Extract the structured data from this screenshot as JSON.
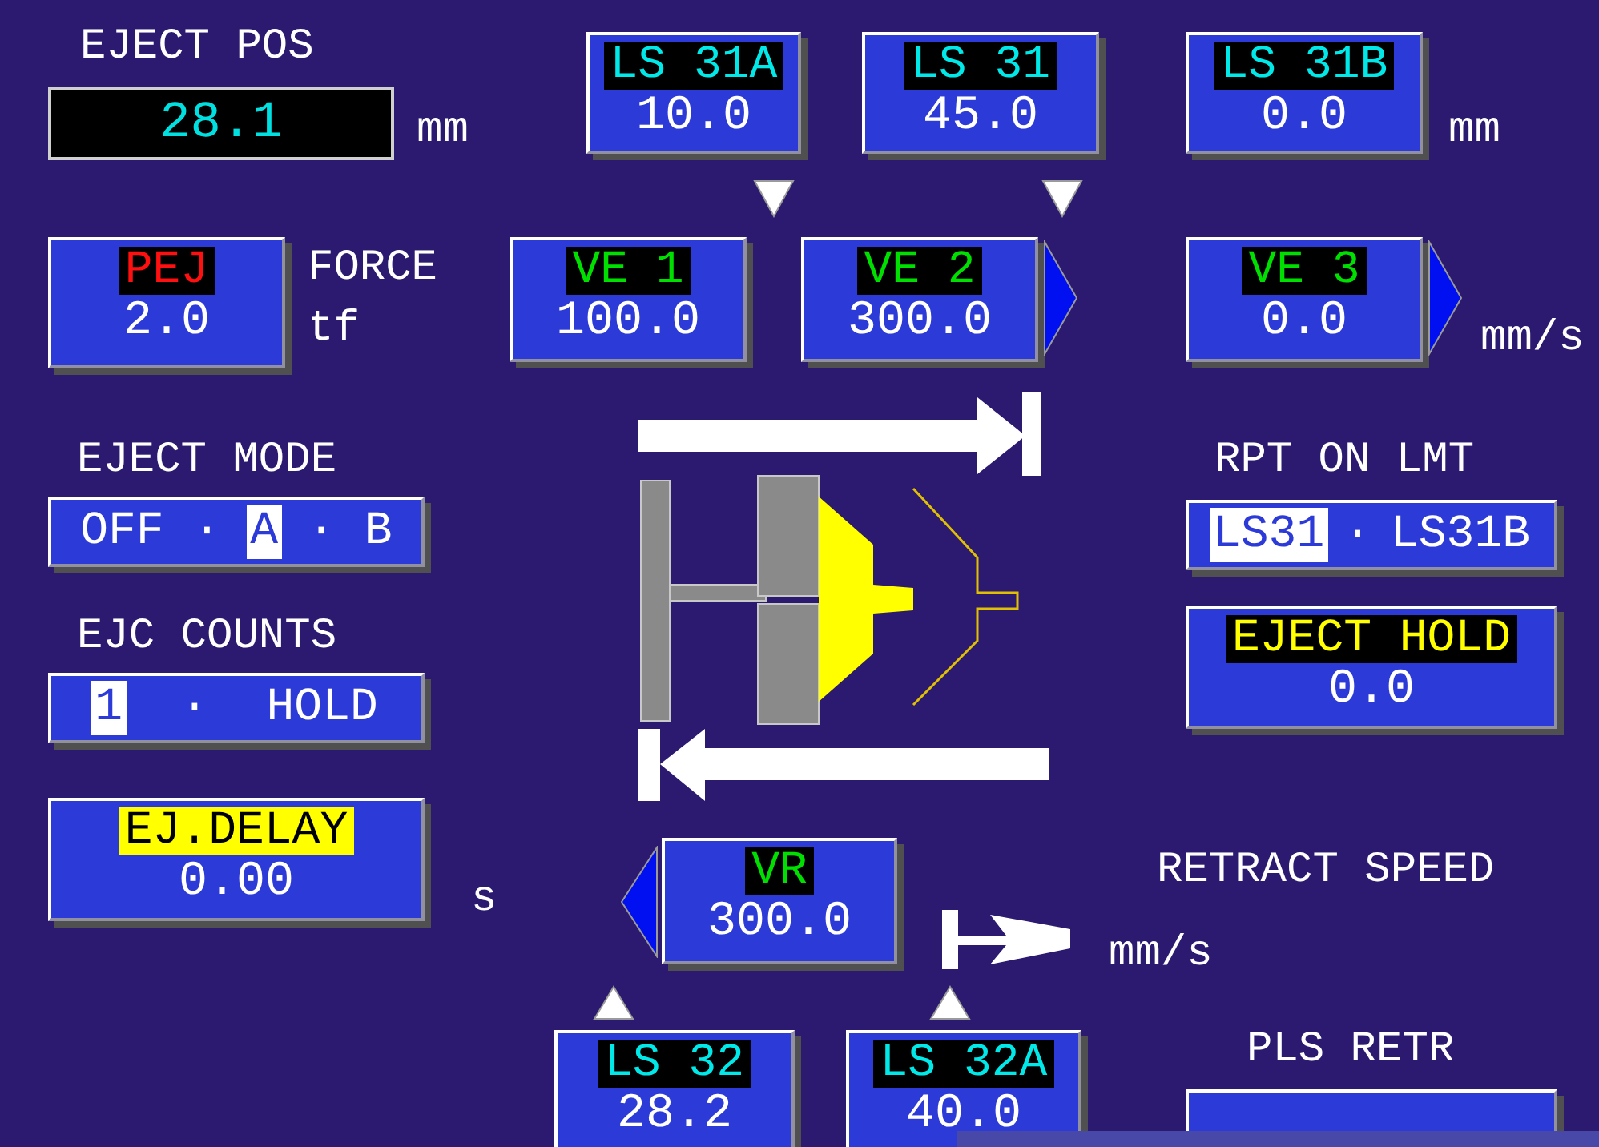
{
  "eject_pos": {
    "value": "28.1"
  },
  "setting_boxes": [
    {
      "label": "LS 31A",
      "value": "10.0",
      "kind": "cyan"
    },
    {
      "label": "LS 31",
      "value": "45.0",
      "kind": "cyan"
    },
    {
      "label": "LS 31B",
      "value": "0.0",
      "kind": "cyan"
    },
    {
      "label": "PEJ",
      "value": "2.0",
      "kind": "red"
    },
    {
      "label": "VE 1",
      "value": "100.0",
      "kind": "green"
    },
    {
      "label": "VE 2",
      "value": "300.0",
      "kind": "green"
    },
    {
      "label": "VE 3",
      "value": "0.0",
      "kind": "green"
    },
    {
      "label": "EJECT HOLD",
      "value": "0.0",
      "kind": "yellow"
    },
    {
      "label": "EJ.DELAY",
      "value": "0.00",
      "kind": "highlight"
    },
    {
      "label": "VR",
      "value": "300.0",
      "kind": "green"
    },
    {
      "label": "LS 32",
      "value": "28.2",
      "kind": "cyan"
    },
    {
      "label": "LS 32A",
      "value": "40.0",
      "kind": "cyan"
    }
  ],
  "captions": [
    "EJECT POS",
    "mm",
    "mm",
    "FORCE",
    "tf",
    "mm/s",
    "EJECT MODE",
    "EJC COUNTS",
    "RPT ON LMT",
    "s",
    "RETRACT SPEED",
    "mm/s",
    "PLS RETR"
  ],
  "selectors": [
    {
      "options": [
        {
          "text": "OFF",
          "kind": "option",
          "selected": false
        },
        {
          "text": "·",
          "kind": "separator"
        },
        {
          "text": "A",
          "kind": "option",
          "selected": true
        },
        {
          "text": "·",
          "kind": "separator"
        },
        {
          "text": "B",
          "kind": "option",
          "selected": false
        }
      ]
    },
    {
      "options": [
        {
          "text": "1",
          "kind": "option",
          "selected": true
        },
        {
          "text": "·",
          "kind": "separator"
        },
        {
          "text": "HOLD",
          "kind": "option",
          "selected": false
        }
      ]
    },
    {
      "options": [
        {
          "text": "LS31",
          "kind": "option",
          "selected": true
        },
        {
          "text": "·",
          "kind": "separator"
        },
        {
          "text": "LS31B",
          "kind": "option",
          "selected": false
        }
      ]
    }
  ]
}
